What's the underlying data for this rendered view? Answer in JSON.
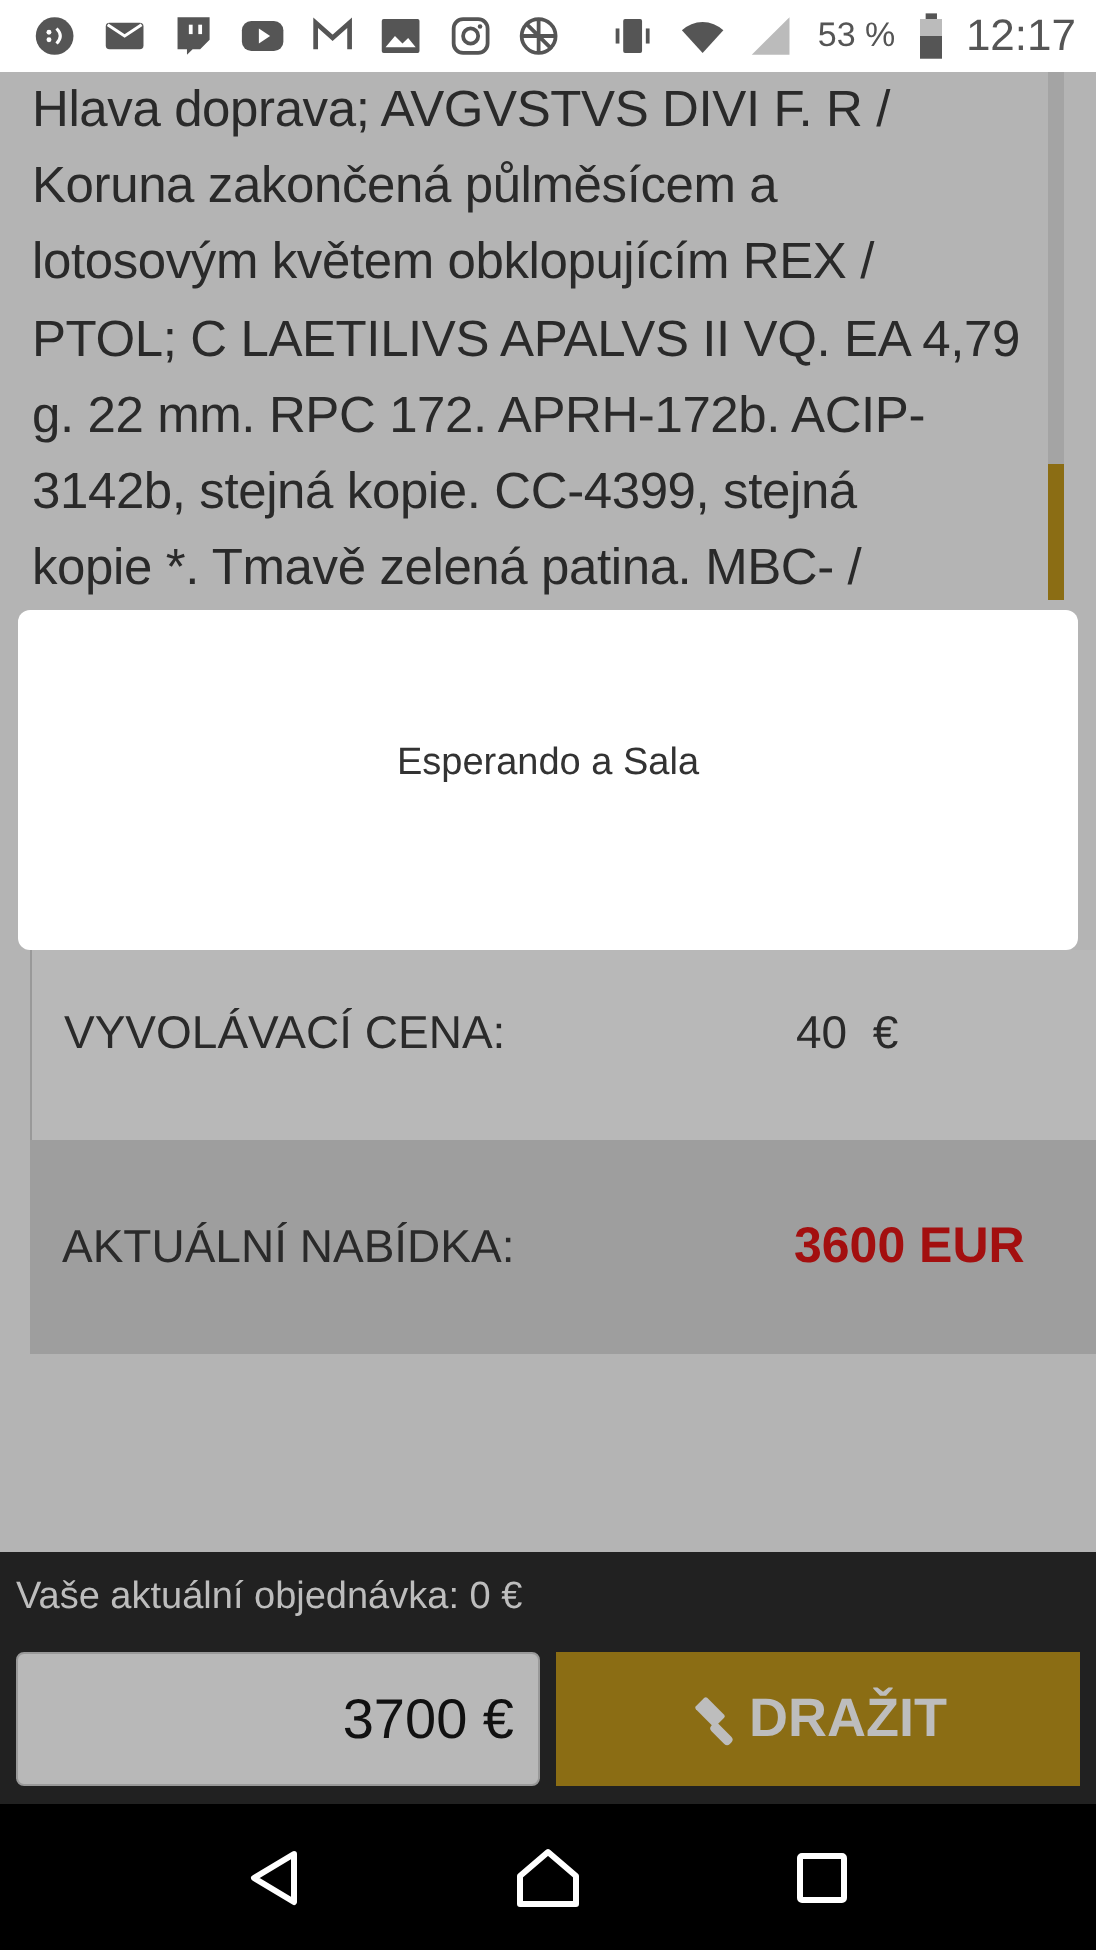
{
  "status_bar": {
    "battery": "53 %",
    "time": "12:17"
  },
  "description": "Hlava doprava; AVGVSTVS DIVI F. R /\nKoruna zakončená půlměsícem a\nlotosovým květem obklopujícím REX /\nPTOL; C LAETILIVS APALVS II VQ. EA 4,79\ng. 22 mm. RPC 172. APRH-172b. ACIP-\n3142b, stejná kopie. CC-4399, stejná\nkopie *. Tmavě zelená patina. MBC- /",
  "dialog": {
    "message": "Esperando a Sala"
  },
  "prices": [
    {
      "kind": "plain",
      "label": "VYVOLÁVACÍ CENA:",
      "value": "40  €"
    },
    {
      "kind": "highlight",
      "label": "AKTUÁLNÍ NABÍDKA:",
      "value": "3600 EUR"
    }
  ],
  "bid_bar": {
    "order_label": "Vaše aktuální objednávka: 0 €",
    "amount": "3700 €",
    "button": "DRAŽIT"
  }
}
